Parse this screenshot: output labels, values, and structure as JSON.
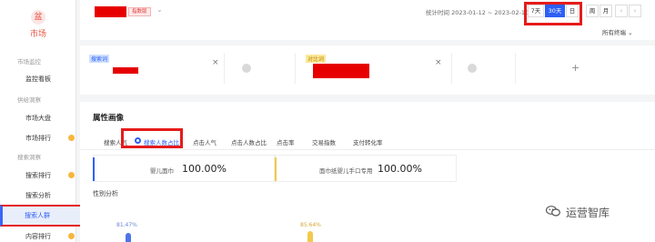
{
  "sidebar": {
    "logo_icon": "盆",
    "logo_label": "市场",
    "sections": [
      {
        "title": "市场监控",
        "items": [
          "监控看板"
        ]
      },
      {
        "title": "供给洞察",
        "items": [
          "市场大盘",
          "市场排行"
        ]
      },
      {
        "title": "搜索洞察",
        "items": [
          "搜索排行",
          "搜索分析",
          "搜索人群"
        ]
      }
    ],
    "extra_item": "内容排行",
    "active_item": "搜索人群",
    "accent": "#2d5ff5",
    "highlight_color": "#e61b1b"
  },
  "header": {
    "badge": "指数版",
    "stat_time": "统计时间 2023-01-12 ~ 2023-02-10",
    "ranges": [
      "7天",
      "30天",
      "日",
      "周",
      "月"
    ],
    "active_range": "30天",
    "prev_icon": "‹",
    "next_icon": "›",
    "all_terminals": "所有终端"
  },
  "compare": {
    "slot1_tag": "搜索词",
    "slot2_tag": "对比词",
    "close_icon": "×",
    "plus_icon": "+"
  },
  "portrait": {
    "title": "属性画像",
    "tabs": [
      "搜索人气",
      "搜索人数占比",
      "点击人气",
      "点击人数占比",
      "点击率",
      "交易指数",
      "支付转化率"
    ],
    "active_tab": "搜索人数占比",
    "metrics": [
      {
        "label": "婴儿面巾",
        "value": "100.00%"
      },
      {
        "label": "面巾纸婴儿手口专用",
        "value": "100.00%"
      }
    ],
    "gender_title": "性别分析",
    "gender_values": [
      "81.47%",
      "85.64%"
    ]
  },
  "watermark": {
    "icon": "wechat-icon",
    "text": "运营智库"
  }
}
